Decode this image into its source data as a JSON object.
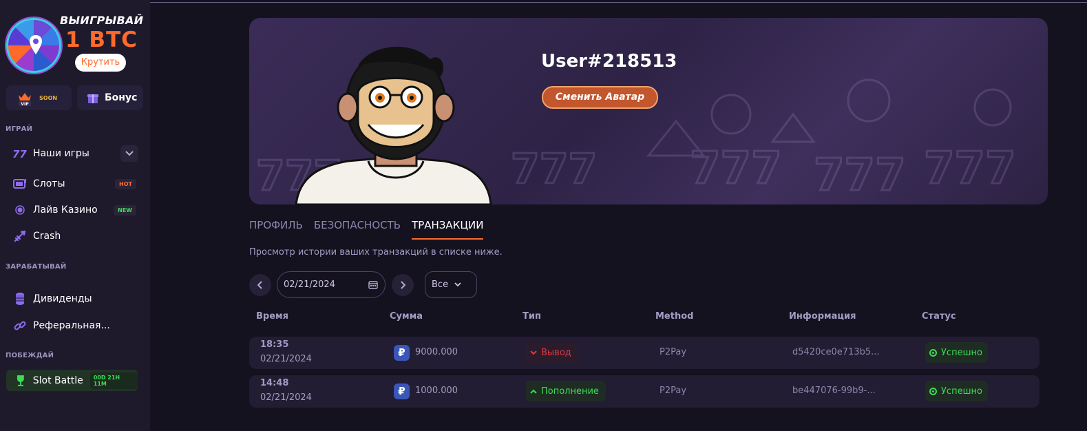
{
  "promo": {
    "title": "ВЫИГРЫВАЙ",
    "amount": "1 BTC",
    "spin_label": "Крутить"
  },
  "chips": {
    "vip_soon": "SOON",
    "vip_text": "VIP",
    "bonus_label": "Бонус"
  },
  "sidebar": {
    "sections": {
      "play": "ИГРАЙ",
      "earn": "ЗАРАБАТЫВАЙ",
      "win": "ПОБЕЖДАЙ"
    },
    "items": [
      {
        "label": "Наши игры",
        "icon": "sevens-icon"
      },
      {
        "label": "Слоты",
        "icon": "slot-machine-icon",
        "badge": "HOT"
      },
      {
        "label": "Лайв Казино",
        "icon": "live-dot-icon",
        "badge": "NEW"
      },
      {
        "label": "Crash",
        "icon": "plane-icon"
      },
      {
        "label": "Дивиденды",
        "icon": "coin-stack-icon"
      },
      {
        "label": "Реферальная...",
        "icon": "link-icon"
      }
    ],
    "slot_battle": {
      "label": "Slot Battle",
      "timer": "00D 21H 11M"
    }
  },
  "profile": {
    "username": "User#218513",
    "change_avatar": "Сменить Аватар"
  },
  "tabs": [
    {
      "label": "ПРОФИЛЬ",
      "active": false
    },
    {
      "label": "БЕЗОПАСНОСТЬ",
      "active": false
    },
    {
      "label": "ТРАНЗАКЦИИ",
      "active": true
    }
  ],
  "hint": "Просмотр истории ваших транзакций в списке ниже.",
  "filters": {
    "date": "02/21/2024",
    "type": "Все"
  },
  "table": {
    "headers": [
      "Время",
      "Сумма",
      "Тип",
      "Method",
      "Информация",
      "Статус"
    ],
    "rows": [
      {
        "time": "18:35",
        "date": "02/21/2024",
        "currency_symbol": "₽",
        "amount": "9000.000",
        "type": "Вывод",
        "direction": "out",
        "method": "P2Pay",
        "info": "d5420ce0e713b5...",
        "status": "Успешно"
      },
      {
        "time": "14:48",
        "date": "02/21/2024",
        "currency_symbol": "₽",
        "amount": "1000.000",
        "type": "Пополнение",
        "direction": "in",
        "method": "P2Pay",
        "info": "be447076-99b9-...",
        "status": "Успешно"
      }
    ]
  },
  "colors": {
    "accent": "#ff6a2b",
    "success": "#3ddc56",
    "danger": "#e0363e",
    "sidebar_bg": "#1e1a2c",
    "page_bg": "#15121f"
  }
}
